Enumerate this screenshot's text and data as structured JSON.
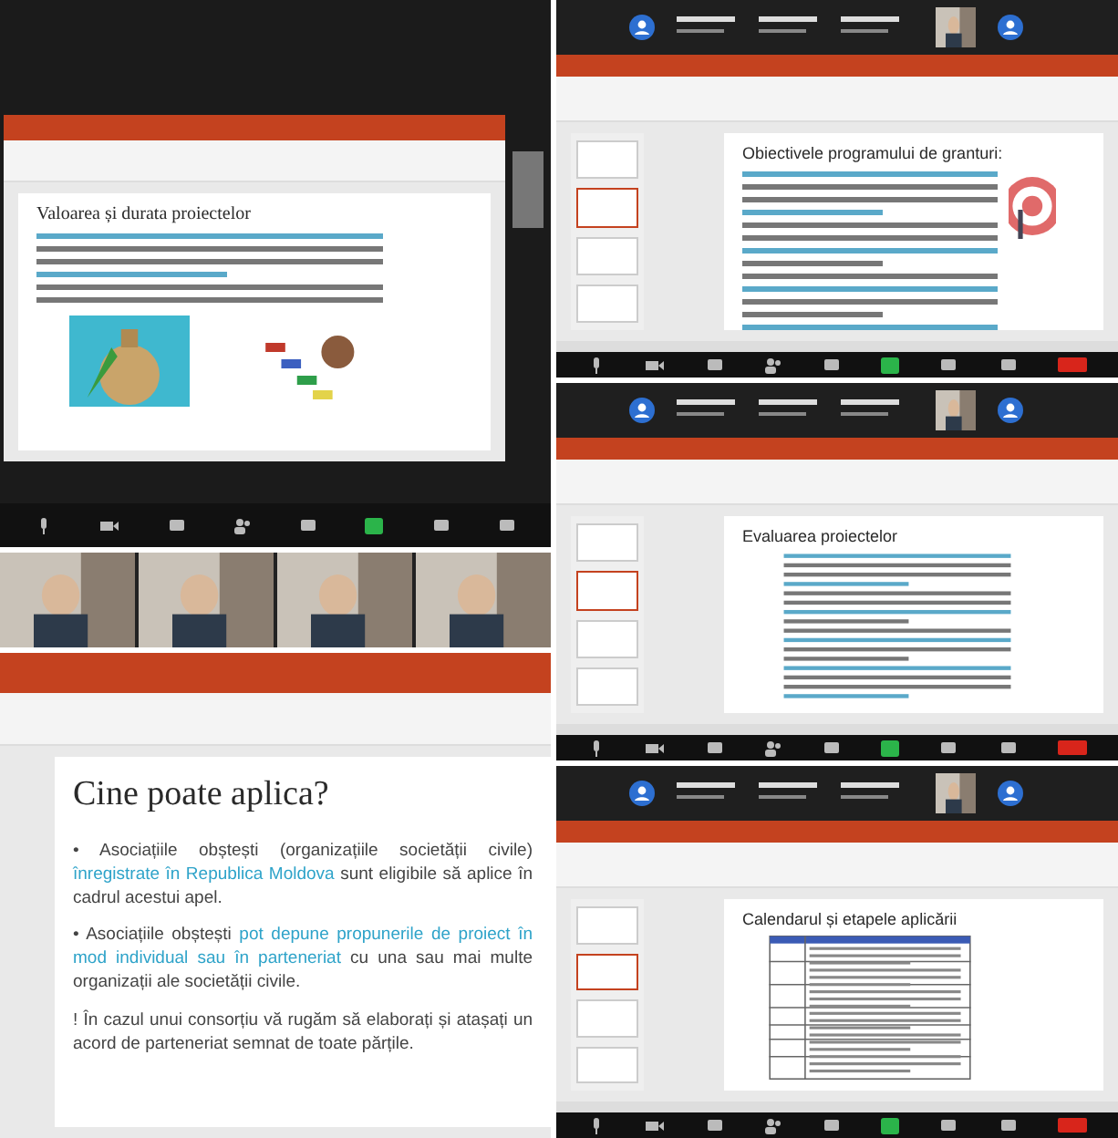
{
  "left_top": {
    "slide_title": "Valoarea și durata proiectelor",
    "kind": "text-with-pictures"
  },
  "left_bottom": {
    "slide_title": "Cine poate aplica?",
    "bullets": [
      {
        "marker": "•",
        "segments": [
          {
            "text": "Asociațiile obștești (organizațiile societății civile) ",
            "highlight": false
          },
          {
            "text": "înregistrate în Republica Moldova",
            "highlight": true
          },
          {
            "text": " sunt eligibile să aplice în cadrul acestui apel.",
            "highlight": false
          }
        ]
      },
      {
        "marker": "•",
        "segments": [
          {
            "text": "Asociațiile obștești ",
            "highlight": false
          },
          {
            "text": "pot depune propunerile de proiect în mod individual sau în parteneriat",
            "highlight": true
          },
          {
            "text": " cu una sau mai multe organizații ale societății civile.",
            "highlight": false
          }
        ]
      },
      {
        "marker": "!",
        "segments": [
          {
            "text": "În cazul unui consorțiu vă rugăm să elaborați și atașați un acord de parteneriat semnat de toate părțile.",
            "highlight": false
          }
        ]
      }
    ]
  },
  "right_panels": [
    {
      "slide_title": "Obiectivele programului de granturi:",
      "kind": "text-with-picture"
    },
    {
      "slide_title": "Evaluarea proiectelor",
      "kind": "text-list"
    },
    {
      "slide_title": "Calendarul și etapele aplicării",
      "kind": "table"
    }
  ]
}
